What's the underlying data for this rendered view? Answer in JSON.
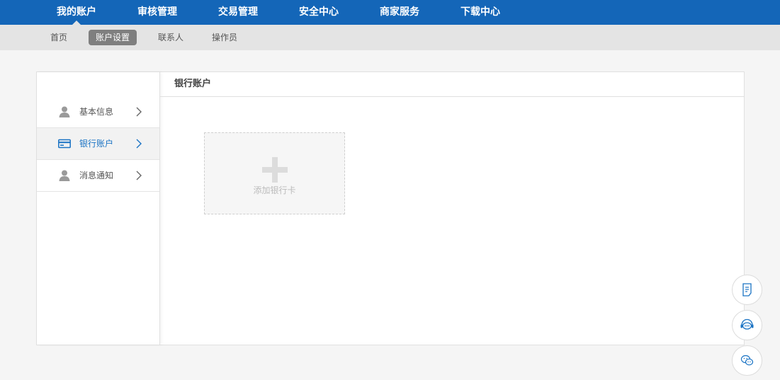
{
  "top_nav": {
    "items": [
      {
        "label": "我的账户"
      },
      {
        "label": "审核管理"
      },
      {
        "label": "交易管理"
      },
      {
        "label": "安全中心"
      },
      {
        "label": "商家服务"
      },
      {
        "label": "下载中心"
      }
    ],
    "active": "我的账户"
  },
  "sub_nav": {
    "items": [
      {
        "label": "首页"
      },
      {
        "label": "账户设置"
      },
      {
        "label": "联系人"
      },
      {
        "label": "操作员"
      }
    ],
    "active": "账户设置"
  },
  "sidebar": {
    "items": [
      {
        "label": "基本信息",
        "icon": "user-icon"
      },
      {
        "label": "银行账户",
        "icon": "bank-card-icon"
      },
      {
        "label": "消息通知",
        "icon": "user-icon"
      }
    ],
    "active": "银行账户"
  },
  "content": {
    "title": "银行账户",
    "add_card_label": "添加银行卡"
  },
  "float_buttons": [
    {
      "icon": "document-icon"
    },
    {
      "icon": "customer-service-icon"
    },
    {
      "icon": "wechat-icon"
    }
  ],
  "colors": {
    "primary": "#1466b8",
    "active_text": "#1a73c4",
    "subnav_bg": "#e4e4e4",
    "subnav_active_bg": "#7f7f7f"
  }
}
